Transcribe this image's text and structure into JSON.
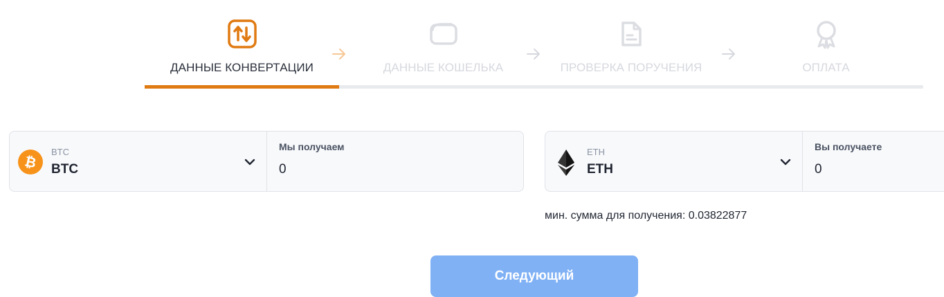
{
  "stepper": {
    "steps": [
      {
        "label": "ДАННЫЕ КОНВЕРТАЦИИ",
        "icon": "exchange-arrows-icon",
        "state": "active"
      },
      {
        "label": "ДАННЫЕ КОШЕЛЬКА",
        "icon": "wallet-icon",
        "state": "inactive"
      },
      {
        "label": "ПРОВЕРКА ПОРУЧЕНИЯ",
        "icon": "document-icon",
        "state": "inactive"
      },
      {
        "label": "ОПЛАТА",
        "icon": "award-badge-icon",
        "state": "inactive"
      }
    ],
    "progress_fraction": 0.25
  },
  "send": {
    "coin_small": "BTC",
    "coin_big": "BTC",
    "icon": "bitcoin-icon",
    "amount_label": "Мы получаем",
    "amount_value": "0"
  },
  "receive": {
    "coin_small": "ETH",
    "coin_big": "ETH",
    "icon": "ethereum-icon",
    "amount_label": "Вы получаете",
    "amount_value": "0"
  },
  "min_note": "мин. сумма для получения: 0.03822877",
  "next_button": "Следующий",
  "colors": {
    "accent": "#e07a12",
    "bitcoin": "#f7931a",
    "button": "#80b1f5",
    "inactive": "#d6d8de"
  }
}
